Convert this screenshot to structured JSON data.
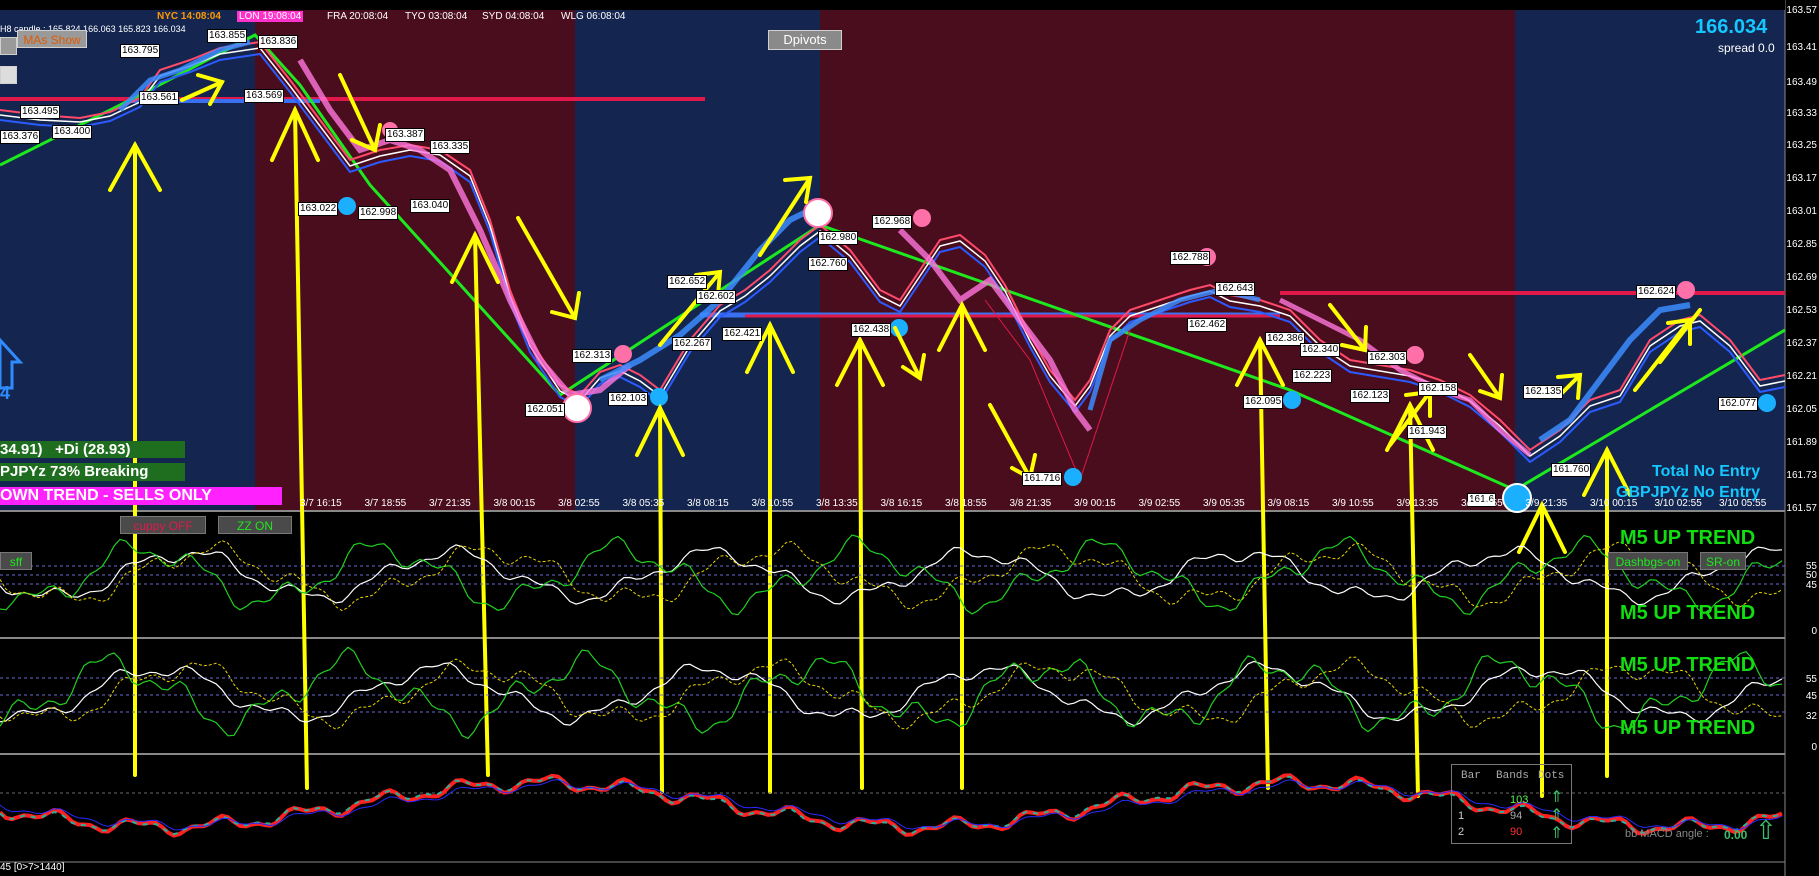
{
  "header": {
    "symbol_info": "H8 candle : 165.824 166.063 165.823 166.034",
    "sessions": [
      {
        "label": "NYC 14:08:04",
        "color": "#ff9900"
      },
      {
        "label": "LON 19:08:04",
        "color": "#ffffff",
        "bg": "#ff33cc"
      },
      {
        "label": "FRA 20:08:04",
        "color": "#ffffff"
      },
      {
        "label": "TYO 03:08:04",
        "color": "#ffffff"
      },
      {
        "label": "SYD 04:08:04",
        "color": "#ffffff"
      },
      {
        "label": "WLG 06:08:04",
        "color": "#ffffff"
      }
    ],
    "price": "166.034",
    "spread": "spread 0.0"
  },
  "buttons": {
    "mas_show": "MAs Show",
    "dpivots": "Dpivots",
    "cuppy_off": "cuppy OFF",
    "zz_on": "ZZ ON",
    "dash_left": "sff",
    "dashbuttons_on": "Dashbgs-on",
    "sr_on": "SR-on",
    "blank_top": "",
    "blank_mid": ""
  },
  "left_info": {
    "di_minus": "34.91)",
    "di_plus": "+Di (28.93)",
    "breaking": "PJPYz 73% Breaking",
    "trend_banner": "OWN TREND - SELLS ONLY",
    "arrow_value": "4"
  },
  "right_info": {
    "total_entry": "Total No Entry",
    "pair_entry": "GBPJPYz No Entry",
    "m5_trends": [
      "M5 UP TREND",
      "M5 UP TREND",
      "M5 UP TREND",
      "M5 UP TREND"
    ]
  },
  "price_axis": [
    "163.57",
    "163.41",
    "163.33",
    "163.17",
    "163.01",
    "162.85",
    "162.69",
    "162.53",
    "162.37",
    "162.21",
    "162.05",
    "161.89",
    "161.73",
    "161.57",
    "163.49",
    "163.25"
  ],
  "time_axis": [
    "3/7 16:15",
    "3/7 18:55",
    "3/7 21:35",
    "3/8 00:15",
    "3/8 02:55",
    "3/8 05:35",
    "3/8 08:15",
    "3/8 10:55",
    "3/8 13:35",
    "3/8 16:15",
    "3/8 18:55",
    "3/8 21:35",
    "3/9 00:15",
    "3/9 02:55",
    "3/9 05:35",
    "3/9 08:15",
    "3/9 10:55",
    "3/9 13:35",
    "3/9 16:55",
    "3/9 21:35",
    "3/10 00:15",
    "3/10 02:55",
    "3/10 05:55"
  ],
  "price_labels": [
    "163.795",
    "163.855",
    "163.836",
    "163.561",
    "163.569",
    "163.495",
    "163.376",
    "163.400",
    "163.387",
    "163.335",
    "163.022",
    "162.998",
    "163.040",
    "162.968",
    "162.980",
    "162.760",
    "162.788",
    "162.643",
    "162.652",
    "162.602",
    "162.438",
    "162.421",
    "162.313",
    "162.267",
    "162.103",
    "162.051",
    "161.716",
    "162.462",
    "162.386",
    "162.340",
    "162.303",
    "162.223",
    "162.123",
    "162.095",
    "162.158",
    "161.943",
    "162.135",
    "161.760",
    "162.624",
    "162.077",
    "161.6"
  ],
  "sub_axis_1": [
    "55",
    "50",
    "45",
    "0"
  ],
  "sub_axis_2": [
    "55",
    "45",
    "32",
    "0"
  ],
  "bands_table": {
    "headers": [
      "Bar",
      "Bands",
      "Dots"
    ],
    "rows": [
      {
        "bar": "",
        "bands": "103",
        "dots": ""
      },
      {
        "bar": "1",
        "bands": "94",
        "dots": ""
      },
      {
        "bar": "2",
        "bands": "90",
        "dots": ""
      }
    ]
  },
  "macd": {
    "label": "bb MACD angle :",
    "value": "0.00"
  },
  "footer": "45 [0>7>1440]",
  "colors": {
    "bull_bg": "#14264f",
    "bear_bg": "#4a0d1e",
    "arrow": "#ffff00",
    "trend_green": "#00ff00",
    "m5_green": "#11dd11",
    "teal_text": "#00e5ff",
    "banner": "#ff22ff"
  }
}
